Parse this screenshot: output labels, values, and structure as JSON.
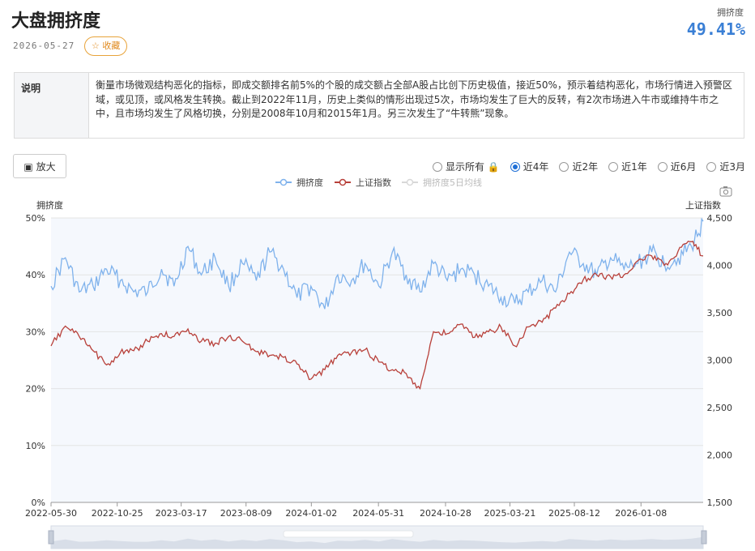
{
  "header": {
    "title": "大盘拥挤度",
    "date": "2026-05-27",
    "favorite_label": "☆ 收藏",
    "kpi_label": "拥挤度",
    "kpi_value": "49.41%"
  },
  "description": {
    "head": "说明",
    "text": "衡量市场微观结构恶化的指标，即成交额排名前5%的个股的成交额占全部A股占比创下历史极值，接近50%，预示着结构恶化，市场行情进入预警区域，或见顶，或风格发生转换。截止到2022年11月，历史上类似的情形出现过5次，市场均发生了巨大的反转，有2次市场进入牛市或维持牛市之中，且市场均发生了风格切换，分别是2008年10月和2015年1月。另三次发生了“牛转熊”现象。"
  },
  "controls": {
    "zoom_label": "▣ 放大",
    "ranges": [
      {
        "label": "显示所有 🔒",
        "selected": false
      },
      {
        "label": "近4年",
        "selected": true
      },
      {
        "label": "近2年",
        "selected": false
      },
      {
        "label": "近1年",
        "selected": false
      },
      {
        "label": "近6月",
        "selected": false
      },
      {
        "label": "近3月",
        "selected": false
      }
    ]
  },
  "colors": {
    "crowding": "#7fb2ec",
    "index": "#b8403a",
    "ma5": "#cccccc",
    "plot_bg": "#f5f8fd",
    "grid": "#e4e4e4"
  },
  "chart_data": {
    "type": "line",
    "legend": [
      "拥挤度",
      "上证指数",
      "拥挤度5日均线"
    ],
    "legend_placement": "top-center",
    "left_axis_title": "拥挤度",
    "right_axis_title": "上证指数",
    "left_ticks": [
      "0%",
      "10%",
      "20%",
      "30%",
      "40%",
      "50%"
    ],
    "ylim_left": [
      0,
      50
    ],
    "right_ticks": [
      "1,500",
      "2,000",
      "2,500",
      "3,000",
      "3,500",
      "4,000",
      "4,500"
    ],
    "ylim_right": [
      1500,
      4500
    ],
    "x_tick_labels": [
      "2022-05-30",
      "2022-10-25",
      "2023-03-17",
      "2023-08-09",
      "2024-01-02",
      "2024-05-31",
      "2024-10-28",
      "2025-03-21",
      "2025-08-12",
      "2026-01-08"
    ],
    "grid": true,
    "series": [
      {
        "name": "拥挤度",
        "x": [
          "2022-05-30",
          "2022-07-01",
          "2022-08-01",
          "2022-09-01",
          "2022-10-01",
          "2022-11-01",
          "2022-12-01",
          "2023-01-01",
          "2023-02-01",
          "2023-03-01",
          "2023-04-01",
          "2023-05-01",
          "2023-06-01",
          "2023-07-01",
          "2023-08-01",
          "2023-09-01",
          "2023-10-01",
          "2023-11-01",
          "2023-12-01",
          "2024-01-01",
          "2024-02-01",
          "2024-03-01",
          "2024-04-01",
          "2024-05-01",
          "2024-06-01",
          "2024-07-01",
          "2024-08-01",
          "2024-09-01",
          "2024-10-01",
          "2024-11-01",
          "2024-12-01",
          "2025-01-01",
          "2025-02-01",
          "2025-03-01",
          "2025-04-01",
          "2025-05-01",
          "2025-06-01",
          "2025-07-01",
          "2025-08-01",
          "2025-09-01",
          "2025-10-01",
          "2025-11-01",
          "2025-12-01",
          "2026-01-01",
          "2026-02-01",
          "2026-03-01",
          "2026-04-01",
          "2026-05-01",
          "2026-05-27"
        ],
        "values": [
          38,
          43,
          37,
          38,
          41,
          39,
          37,
          37,
          41,
          38,
          45,
          40,
          43,
          38,
          42,
          39,
          44,
          41,
          36,
          38,
          34,
          40,
          39,
          42,
          38,
          44,
          40,
          37,
          42,
          39,
          41,
          40,
          38,
          36,
          35,
          37,
          39,
          37,
          44,
          42,
          40,
          43,
          41,
          42,
          44,
          42,
          43,
          45,
          49.41
        ]
      },
      {
        "name": "上证指数",
        "x": [
          "2022-05-30",
          "2022-07-01",
          "2022-08-01",
          "2022-09-01",
          "2022-10-01",
          "2022-11-01",
          "2022-12-01",
          "2023-01-01",
          "2023-02-01",
          "2023-03-01",
          "2023-04-01",
          "2023-05-01",
          "2023-06-01",
          "2023-07-01",
          "2023-08-01",
          "2023-09-01",
          "2023-10-01",
          "2023-11-01",
          "2023-12-01",
          "2024-01-01",
          "2024-02-01",
          "2024-03-01",
          "2024-04-01",
          "2024-05-01",
          "2024-06-01",
          "2024-07-01",
          "2024-08-01",
          "2024-09-01",
          "2024-10-01",
          "2024-11-01",
          "2024-12-01",
          "2025-01-01",
          "2025-02-01",
          "2025-03-01",
          "2025-04-01",
          "2025-05-01",
          "2025-06-01",
          "2025-07-01",
          "2025-08-01",
          "2025-09-01",
          "2025-10-01",
          "2025-11-01",
          "2025-12-01",
          "2026-01-01",
          "2026-02-01",
          "2026-03-01",
          "2026-04-01",
          "2026-05-01",
          "2026-05-27"
        ],
        "values": [
          3150,
          3360,
          3250,
          3100,
          2950,
          3080,
          3100,
          3200,
          3280,
          3250,
          3330,
          3200,
          3180,
          3250,
          3200,
          3090,
          3050,
          3030,
          2960,
          2800,
          2900,
          3050,
          3080,
          3110,
          2980,
          2900,
          2860,
          2700,
          3300,
          3280,
          3380,
          3240,
          3300,
          3350,
          3150,
          3350,
          3400,
          3550,
          3700,
          3850,
          3900,
          3880,
          3900,
          4050,
          4100,
          4000,
          4150,
          4250,
          4100
        ]
      },
      {
        "name": "拥挤度5日均线",
        "x": [],
        "values": [],
        "hidden": true
      }
    ]
  }
}
